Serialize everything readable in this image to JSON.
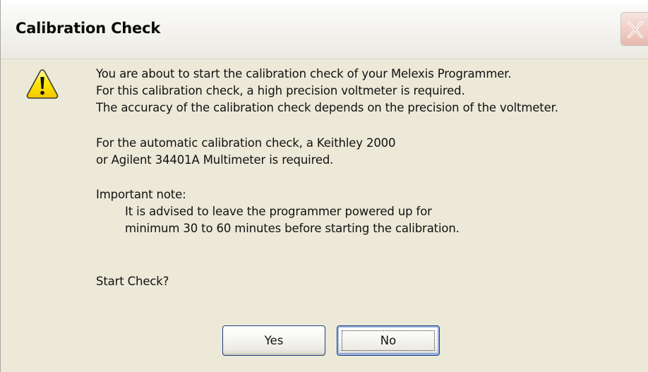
{
  "window": {
    "title": "Calibration Check",
    "close_icon": "close-x-icon"
  },
  "message": {
    "icon": "warning-icon",
    "lines": [
      "You are about to start the calibration check of your Melexis Programmer.",
      "For this calibration check, a high precision voltmeter is required.",
      "The accuracy of the calibration check depends on the precision of the voltmeter.",
      "For the automatic calibration check, a Keithley 2000",
      "or Agilent 34401A Multimeter is required.",
      "Important note:",
      "It is advised to leave the programmer powered up for",
      "minimum 30 to 60 minutes before starting the calibration.",
      "Start Check?"
    ]
  },
  "buttons": {
    "yes_label": "Yes",
    "no_label": "No"
  },
  "colors": {
    "dialog_bg": "#ece9d8",
    "button_border": "#1d3f78",
    "close_button": "#e8b9ae",
    "warning_fill": "#ffe600"
  }
}
